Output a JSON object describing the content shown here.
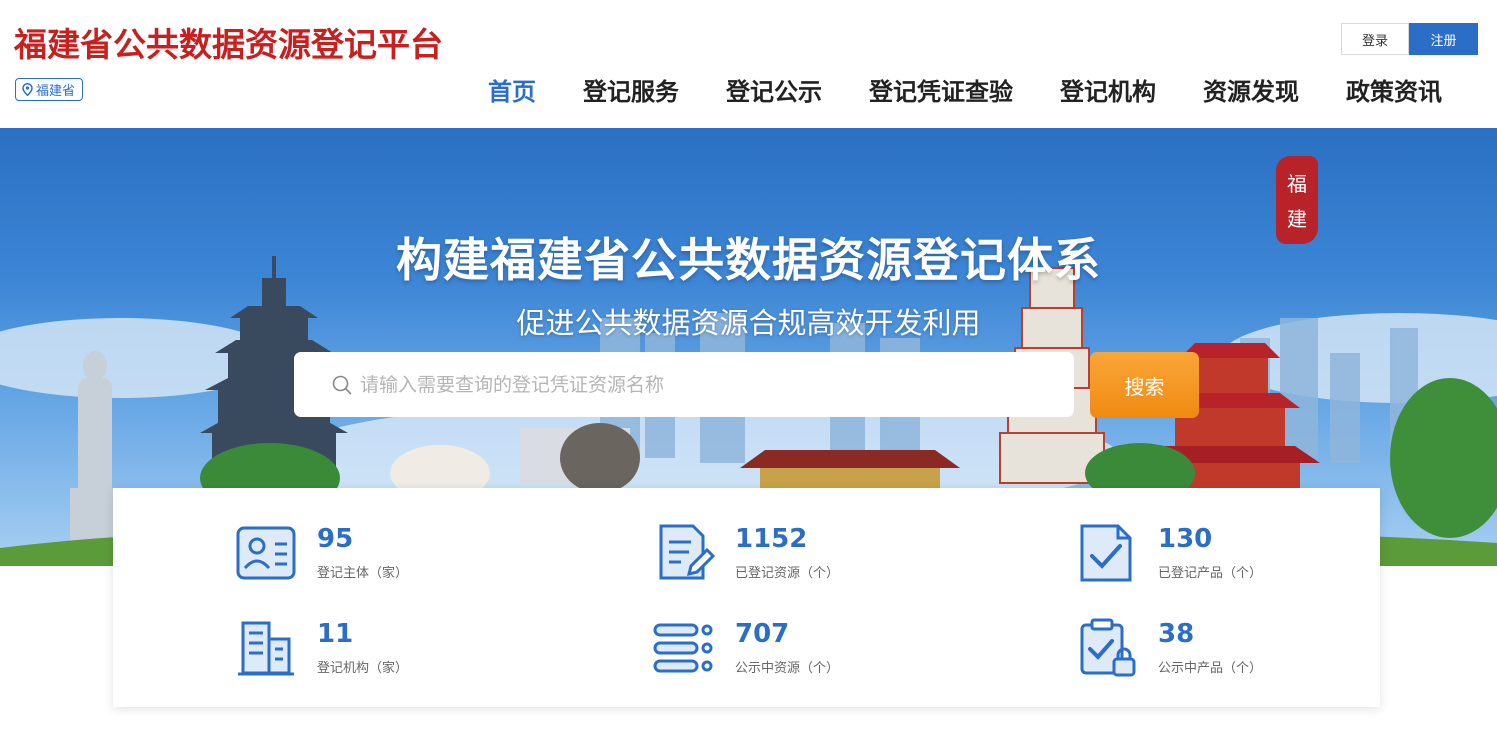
{
  "header": {
    "site_title": "福建省公共数据资源登记平台",
    "region": "福建省",
    "login_label": "登录",
    "register_label": "注册"
  },
  "nav": {
    "items": [
      {
        "label": "首页",
        "active": true
      },
      {
        "label": "登记服务"
      },
      {
        "label": "登记公示"
      },
      {
        "label": "登记凭证查验"
      },
      {
        "label": "登记机构"
      },
      {
        "label": "资源发现"
      },
      {
        "label": "政策资讯"
      }
    ]
  },
  "hero": {
    "title": "构建福建省公共数据资源登记体系",
    "subtitle": "促进公共数据资源合规高效开发利用",
    "seal_chars": [
      "福",
      "建"
    ]
  },
  "search": {
    "placeholder": "请输入需要查询的登记凭证资源名称",
    "value": "",
    "button_label": "搜索"
  },
  "stats": [
    {
      "icon": "id-card-icon",
      "value": "95",
      "label": "登记主体（家）"
    },
    {
      "icon": "document-edit-icon",
      "value": "1152",
      "label": "已登记资源（个）"
    },
    {
      "icon": "document-check-icon",
      "value": "130",
      "label": "已登记产品（个）"
    },
    {
      "icon": "building-icon",
      "value": "11",
      "label": "登记机构（家）"
    },
    {
      "icon": "list-icon",
      "value": "707",
      "label": "公示中资源（个）"
    },
    {
      "icon": "clipboard-check-icon",
      "value": "38",
      "label": "公示中产品（个）"
    }
  ],
  "colors": {
    "brand_red": "#c81f1f",
    "primary_blue": "#2a6ec8",
    "search_orange": "#f08a10"
  }
}
